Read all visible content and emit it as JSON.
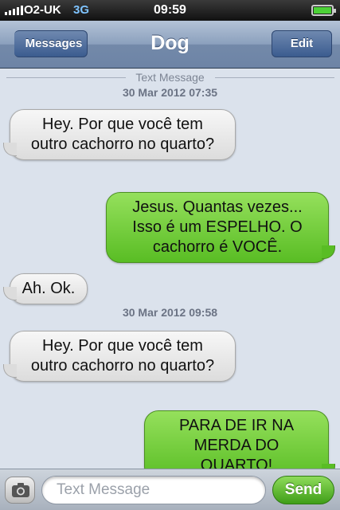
{
  "status_bar": {
    "carrier": "O2-UK",
    "network": "3G",
    "time": "09:59",
    "battery_level": 1.0
  },
  "nav": {
    "back_label": "Messages",
    "title": "Dog",
    "edit_label": "Edit"
  },
  "thread": {
    "header_label": "Text Message",
    "timestamp_1": "30 Mar 2012 07:35",
    "timestamp_2": "30 Mar 2012 09:58",
    "messages": [
      {
        "direction": "incoming",
        "lines": [
          "Hey. Por que você tem",
          "outro cachorro no quarto?"
        ]
      },
      {
        "direction": "outgoing",
        "lines": [
          "Jesus. Quantas vezes...",
          "Isso é um ESPELHO. O",
          "cachorro é VOCÊ."
        ]
      },
      {
        "direction": "incoming",
        "lines": [
          "Ah. Ok."
        ]
      },
      {
        "direction": "incoming",
        "lines": [
          "Hey. Por que você tem",
          "outro cachorro no quarto?"
        ]
      },
      {
        "direction": "outgoing",
        "lines": [
          "PARA DE IR NA",
          "MERDA DO QUARTO!"
        ]
      }
    ]
  },
  "composer": {
    "placeholder": "Text Message",
    "send_label": "Send",
    "camera_icon": "camera-icon"
  },
  "colors": {
    "incoming_bubble": "#e8e8e8",
    "outgoing_bubble": "#6fcb38",
    "background": "#dbe2ec",
    "nav_bar": "#7d92b2"
  }
}
